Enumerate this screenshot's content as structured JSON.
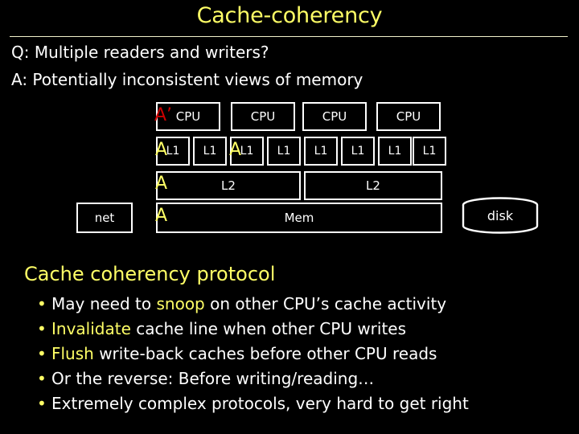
{
  "slide": {
    "title": "Cache-coherency",
    "background_color": "#000000",
    "accent_color": "#ffff66",
    "text_color": "#ffffff",
    "marker_red_color": "#cc0000"
  },
  "qa": {
    "question": "Q: Multiple readers and writers?",
    "answer": "A: Potentially inconsistent views of memory"
  },
  "diagram": {
    "net_label": "net",
    "disk_label": "disk",
    "cpus": [
      {
        "label": "CPU",
        "marker": "A’",
        "marker_color": "red"
      },
      {
        "label": "CPU",
        "marker": "",
        "marker_color": ""
      },
      {
        "label": "CPU",
        "marker": "",
        "marker_color": ""
      },
      {
        "label": "CPU",
        "marker": "",
        "marker_color": ""
      }
    ],
    "l1_caches": [
      {
        "label": "L1",
        "marker": "A",
        "marker_color": "yellow"
      },
      {
        "label": "L1",
        "marker": "",
        "marker_color": ""
      },
      {
        "label": "L1",
        "marker": "A",
        "marker_color": "yellow"
      },
      {
        "label": "L1",
        "marker": "",
        "marker_color": ""
      },
      {
        "label": "L1",
        "marker": "",
        "marker_color": ""
      },
      {
        "label": "L1",
        "marker": "",
        "marker_color": ""
      },
      {
        "label": "L1",
        "marker": "",
        "marker_color": ""
      },
      {
        "label": "L1",
        "marker": "",
        "marker_color": ""
      }
    ],
    "l2_caches": [
      {
        "label": "L2",
        "marker": "A",
        "marker_color": "yellow"
      },
      {
        "label": "L2",
        "marker": "",
        "marker_color": ""
      }
    ],
    "memory": {
      "label": "Mem",
      "marker": "A",
      "marker_color": "yellow"
    }
  },
  "protocol": {
    "heading": "Cache coherency protocol",
    "bullet_char": "•",
    "bullets": [
      {
        "pre": "May need to ",
        "hl": "snoop",
        "post": " on other CPU’s cache activity"
      },
      {
        "pre": "",
        "hl": "Invalidate",
        "post": " cache line when other CPU writes"
      },
      {
        "pre": "",
        "hl": "Flush",
        "post": " write-back caches before other CPU reads"
      },
      {
        "pre": "Or the reverse: Before writing/reading…",
        "hl": "",
        "post": ""
      },
      {
        "pre": "Extremely complex protocols, very hard to get right",
        "hl": "",
        "post": ""
      }
    ]
  }
}
